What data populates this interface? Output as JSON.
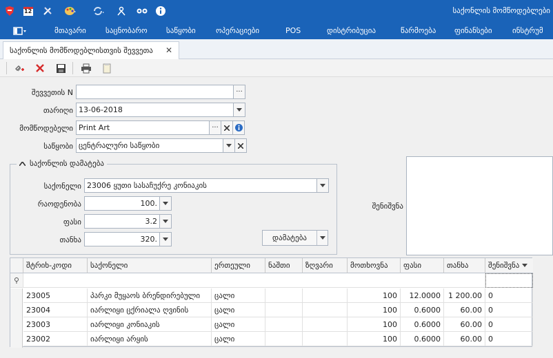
{
  "app": {
    "title": "საქონლის მომწოდებლები",
    "accent_color": "#1a63b8",
    "quick_access_icons": [
      "shield-app-icon",
      "calendar-icon",
      "tools-icon",
      "palette-icon",
      "refresh-icon",
      "user-icon",
      "glasses-icon",
      "info-icon"
    ],
    "calendar_day": "12"
  },
  "menu": {
    "items": [
      "მთავარი",
      "საცნობარო",
      "საწყობი",
      "ოპერაციები",
      "POS",
      "დისტრიბუცია",
      "წარმოება",
      "ფინანსები",
      "ინსტრუმ"
    ]
  },
  "document_tab": {
    "label": "საქონლის მომწოდებლისთვის შევვეთა",
    "close": "✕"
  },
  "toolbar": {
    "icons": [
      "add-link-icon",
      "delete-icon",
      "save-icon",
      "print-icon",
      "clipboard-icon"
    ]
  },
  "form": {
    "order_no_label": "შევვეთის N",
    "order_no_value": "",
    "date_label": "თარიღი",
    "date_value": "13-06-2018",
    "supplier_label": "მომწოდებელი",
    "supplier_value": "Print Art",
    "warehouse_label": "საწყობი",
    "warehouse_value": "ცენტრალური საწყობი",
    "notes_label": "შენიშვნა",
    "ellipsis": "···"
  },
  "add_group": {
    "title": "საქონლის დამატება",
    "item_label": "საქონელი",
    "item_value": "23006   ყუთი სასაჩუქრე კონიაკის",
    "qty_label": "რაოდენობა",
    "qty_value": "100.",
    "price_label": "ფასი",
    "price_value": "3.2",
    "sum_label": "თანხა",
    "sum_value": "320.",
    "add_button": "დამატება"
  },
  "grid": {
    "columns": [
      "შტრიხ-კოდი",
      "საქონელი",
      "ერთეული",
      "ნაშთი",
      "ზღვარი",
      "მოთხოვნა",
      "ფასი",
      "თანხა",
      "შენიშვნა"
    ],
    "rows": [
      [
        "23005",
        "პარკი მუყაოს ბრენდირებული",
        "ცალი",
        "",
        "",
        "100",
        "12.0000",
        "1 200.00",
        "0"
      ],
      [
        "23004",
        "იარლიყი ცქრიალა ღვინის",
        "ცალი",
        "",
        "",
        "100",
        "0.6000",
        "60.00",
        "0"
      ],
      [
        "23003",
        "იარლიყი კონიაკის",
        "ცალი",
        "",
        "",
        "100",
        "0.6000",
        "60.00",
        "0"
      ],
      [
        "23002",
        "იარლიყი არყის",
        "ცალი",
        "",
        "",
        "100",
        "0.6000",
        "60.00",
        "0"
      ]
    ]
  }
}
